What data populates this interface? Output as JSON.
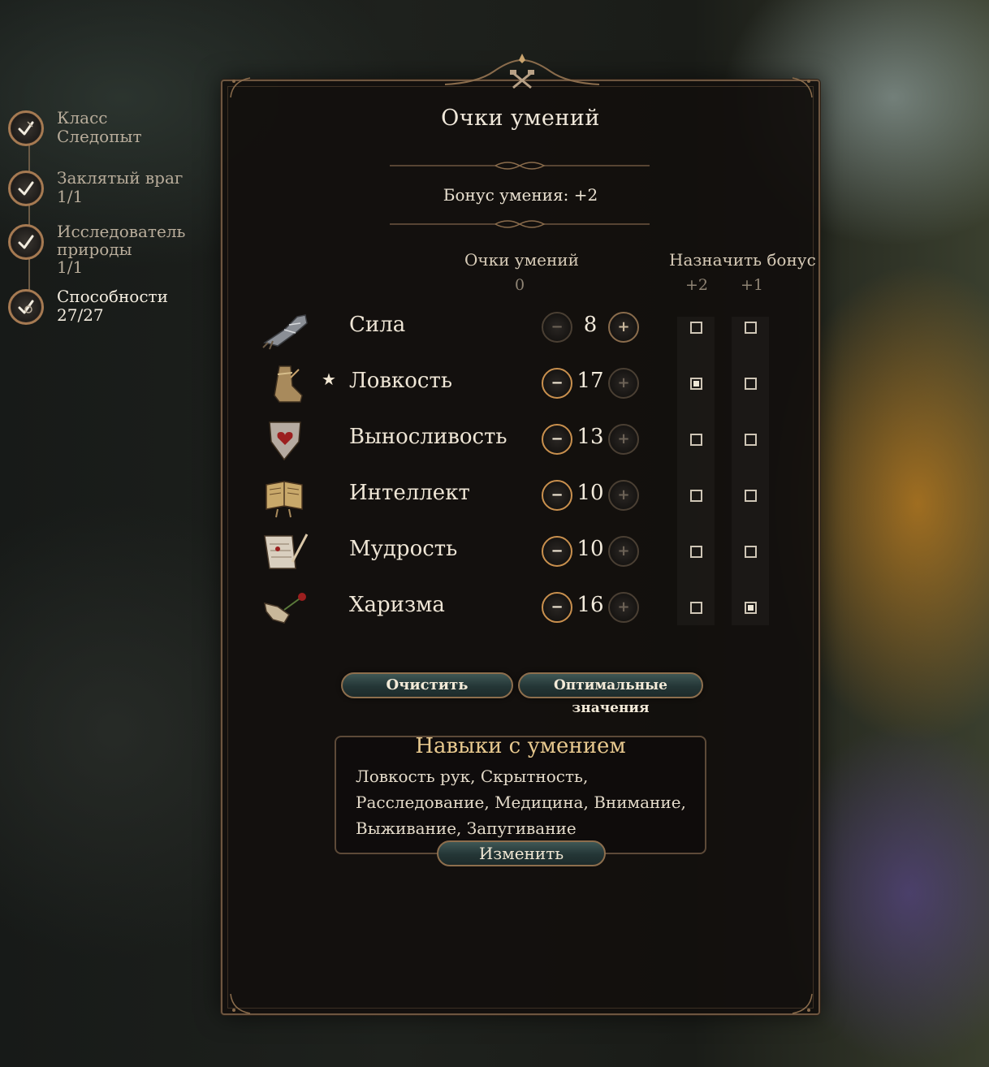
{
  "steps": [
    {
      "title": "Класс",
      "subtitle": "Следопыт",
      "icon": "class-icon"
    },
    {
      "title": "Заклятый враг",
      "subtitle": "1/1",
      "icon": "check-icon"
    },
    {
      "title": "Исследователь",
      "title2": "природы",
      "subtitle": "1/1",
      "icon": "check-icon"
    },
    {
      "title": "Способности",
      "subtitle": "27/27",
      "icon": "abilities-icon"
    }
  ],
  "panel": {
    "title": "Очки умений",
    "proficiency_bonus": "Бонус умения: +2",
    "points_header": "Очки умений",
    "points_remaining": "0",
    "assign_bonus_header": "Назначить бонус",
    "bonus_plus2": "+2",
    "bonus_plus1": "+1"
  },
  "abilities": [
    {
      "name": "Сила",
      "value": "8",
      "icon": "gauntlet-icon",
      "primary": false,
      "plus2": false,
      "plus1": false
    },
    {
      "name": "Ловкость",
      "value": "17",
      "icon": "boot-icon",
      "primary": true,
      "star": "★",
      "plus2": true,
      "plus1": false
    },
    {
      "name": "Выносливость",
      "value": "13",
      "icon": "heart-shield-icon",
      "primary": false,
      "plus2": false,
      "plus1": false
    },
    {
      "name": "Интеллект",
      "value": "10",
      "icon": "book-icon",
      "primary": false,
      "plus2": false,
      "plus1": false
    },
    {
      "name": "Мудрость",
      "value": "10",
      "icon": "scroll-quill-icon",
      "primary": false,
      "plus2": false,
      "plus1": false
    },
    {
      "name": "Харизма",
      "value": "16",
      "icon": "hand-rose-icon",
      "primary": false,
      "plus2": false,
      "plus1": true
    }
  ],
  "buttons": {
    "reset": "Очистить",
    "optimal": "Оптимальные значения",
    "edit": "Изменить",
    "minus": "−",
    "plus": "+"
  },
  "skills": {
    "title": "Навыки с умением",
    "line1": "Ловкость рук, Скрытность,",
    "line2": "Расследование, Медицина, Внимание,",
    "line3": "Выживание, Запугивание"
  },
  "colors": {
    "accent_gold": "#e8c98f",
    "frame_bronze": "#8a6c4c",
    "button_teal": "#243636",
    "minus_active_border": "#c9904e",
    "plus_disabled": "#6c6256"
  }
}
